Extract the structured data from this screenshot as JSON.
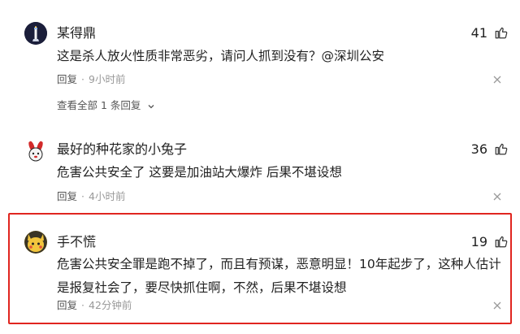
{
  "comments": [
    {
      "username": "某得鼎",
      "likes": "41",
      "text": "这是杀人放火性质非常恶劣，请问人抓到没有？@深圳公安",
      "reply_label": "回复",
      "time": "9小时前",
      "replies_label": "查看全部 1 条回复"
    },
    {
      "username": "最好的种花家的小兔子",
      "likes": "36",
      "text": "危害公共安全了 这要是加油站大爆炸 后果不堪设想",
      "reply_label": "回复",
      "time": "4小时前"
    },
    {
      "username": "手不慌",
      "likes": "19",
      "text": "危害公共安全罪是跑不掉了，而且有预谋，恶意明显！10年起步了，这种人估计是报复社会了，要尽快抓住啊，不然，后果不堪设想",
      "reply_label": "回复",
      "time": "42分钟前"
    }
  ],
  "colors": {
    "highlight_border": "#e0251f",
    "meta_gray": "#999999"
  },
  "icons": [
    "lighthouse-avatar",
    "rabbit-avatar",
    "pikachu-avatar",
    "thumb-up-icon",
    "close-icon",
    "chevron-down-icon"
  ]
}
